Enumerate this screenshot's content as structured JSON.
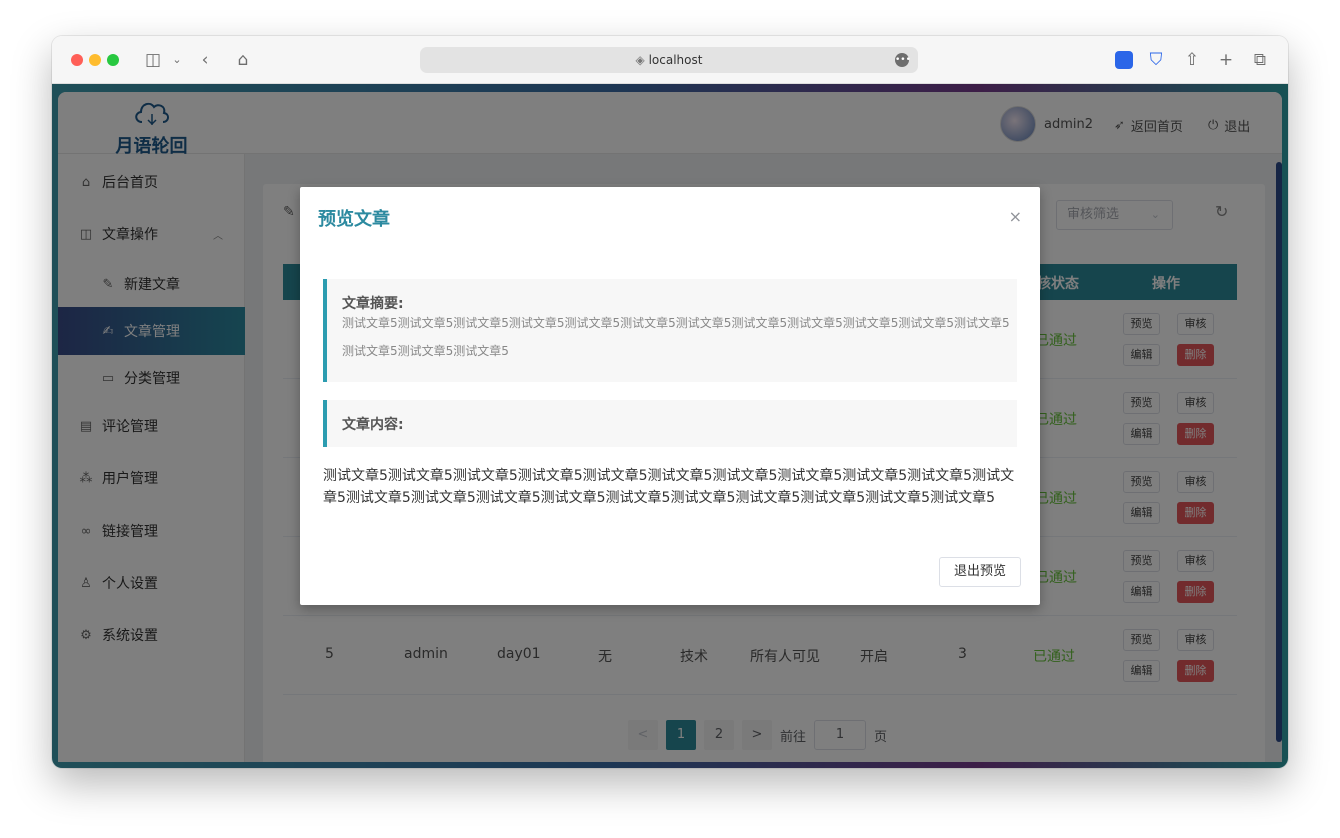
{
  "browser": {
    "url": "localhost"
  },
  "header": {
    "logo_text": "月语轮回",
    "username": "admin2",
    "back_home": "返回首页",
    "logout": "退出"
  },
  "sidebar": {
    "items": [
      {
        "label": "后台首页",
        "icon": "home-icon"
      },
      {
        "label": "文章操作",
        "icon": "book-icon"
      },
      {
        "label": "新建文章",
        "icon": "pen-icon"
      },
      {
        "label": "文章管理",
        "icon": "edit-icon"
      },
      {
        "label": "分类管理",
        "icon": "folder-icon"
      },
      {
        "label": "评论管理",
        "icon": "comment-icon"
      },
      {
        "label": "用户管理",
        "icon": "users-icon"
      },
      {
        "label": "链接管理",
        "icon": "link-icon"
      },
      {
        "label": "个人设置",
        "icon": "user-icon"
      },
      {
        "label": "系统设置",
        "icon": "gear-icon"
      }
    ]
  },
  "main": {
    "filter_placeholder": "审核筛选",
    "headers": {
      "status": "核状态",
      "actions": "操作"
    },
    "rows": [
      {
        "status": "已通过"
      },
      {
        "status": "已通过"
      },
      {
        "status": "已通过"
      },
      {
        "status": "已通过"
      },
      {
        "id": "5",
        "author": "admin",
        "title": "day01",
        "tag": "无",
        "category": "技术",
        "visibility": "所有人可见",
        "comment": "开启",
        "views": "3",
        "status": "已通过"
      }
    ],
    "actions": {
      "preview": "预览",
      "review": "审核",
      "edit": "编辑",
      "delete": "删除"
    },
    "pager": {
      "prev": "<",
      "page1": "1",
      "page2": "2",
      "next": ">",
      "goto": "前往",
      "goto_value": "1",
      "page_suffix": "页"
    }
  },
  "dialog": {
    "title": "预览文章",
    "close": "×",
    "summary_title": "文章摘要:",
    "summary_text": "测试文章5测试文章5测试文章5测试文章5测试文章5测试文章5测试文章5测试文章5测试文章5测试文章5测试文章5测试文章5测试文章5测试文章5测试文章5",
    "content_title": "文章内容:",
    "content_text": "测试文章5测试文章5测试文章5测试文章5测试文章5测试文章5测试文章5测试文章5测试文章5测试文章5测试文章5测试文章5测试文章5测试文章5测试文章5测试文章5测试文章5测试文章5测试文章5测试文章5测试文章5",
    "exit_button": "退出预览"
  },
  "colors": {
    "accent": "#2c8a9b",
    "success": "#67c23a",
    "danger": "#e4575a"
  }
}
